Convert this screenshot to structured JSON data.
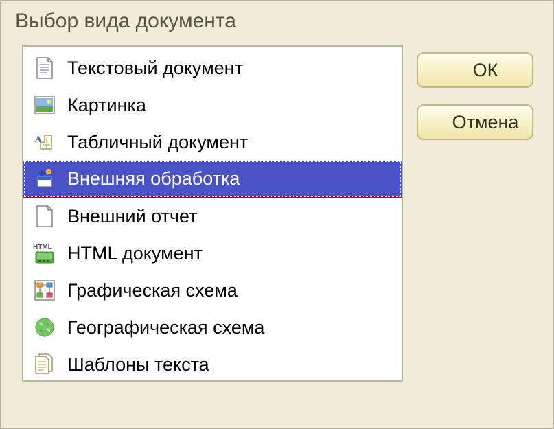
{
  "dialog": {
    "title": "Выбор вида документа"
  },
  "buttons": {
    "ok": "ОК",
    "cancel": "Отмена"
  },
  "list": {
    "items": [
      {
        "icon": "text-document-icon",
        "label": "Текстовый документ",
        "selected": false
      },
      {
        "icon": "picture-icon",
        "label": "Картинка",
        "selected": false
      },
      {
        "icon": "spreadsheet-icon",
        "label": "Табличный документ",
        "selected": false
      },
      {
        "icon": "external-processing-icon",
        "label": "Внешняя обработка",
        "selected": true
      },
      {
        "icon": "external-report-icon",
        "label": "Внешний отчет",
        "selected": false
      },
      {
        "icon": "html-document-icon",
        "label": "HTML документ",
        "selected": false
      },
      {
        "icon": "graphic-schema-icon",
        "label": "Графическая схема",
        "selected": false
      },
      {
        "icon": "geographic-schema-icon",
        "label": "Географическая схема",
        "selected": false
      },
      {
        "icon": "text-templates-icon",
        "label": "Шаблоны текста",
        "selected": false
      }
    ]
  }
}
